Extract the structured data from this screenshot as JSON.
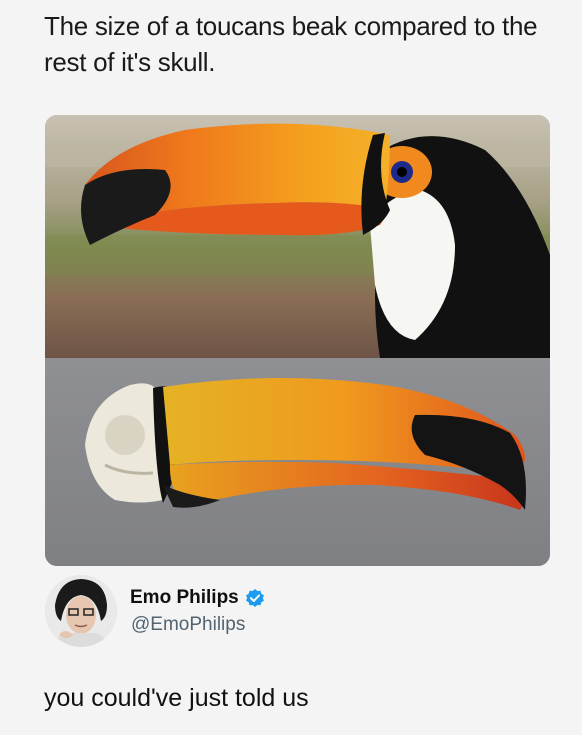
{
  "post": {
    "title": "The size of a toucans beak compared to the rest of it's skull."
  },
  "tweet": {
    "author_name": "Emo Philips",
    "author_handle": "@EmoPhilips",
    "text": "you could've just told us",
    "verified": true
  },
  "colors": {
    "verified_blue": "#1d9bf0",
    "handle_gray": "#536471",
    "background": "#f4f4f4"
  },
  "icons": {
    "verified": "verified-badge-icon"
  }
}
